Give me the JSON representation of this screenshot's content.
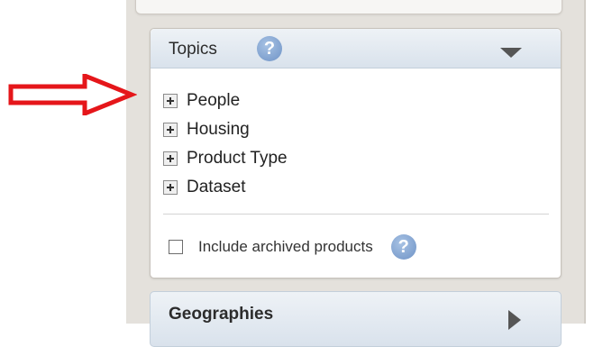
{
  "topics_panel": {
    "title": "Topics",
    "help": "?",
    "items": [
      {
        "label": "People"
      },
      {
        "label": "Housing"
      },
      {
        "label": "Product Type"
      },
      {
        "label": "Dataset"
      }
    ],
    "archive_checkbox": {
      "label": "Include archived products",
      "checked": false
    },
    "archive_help": "?"
  },
  "geographies_panel": {
    "title": "Geographies"
  },
  "annotation": {
    "color": "#e5161a"
  }
}
